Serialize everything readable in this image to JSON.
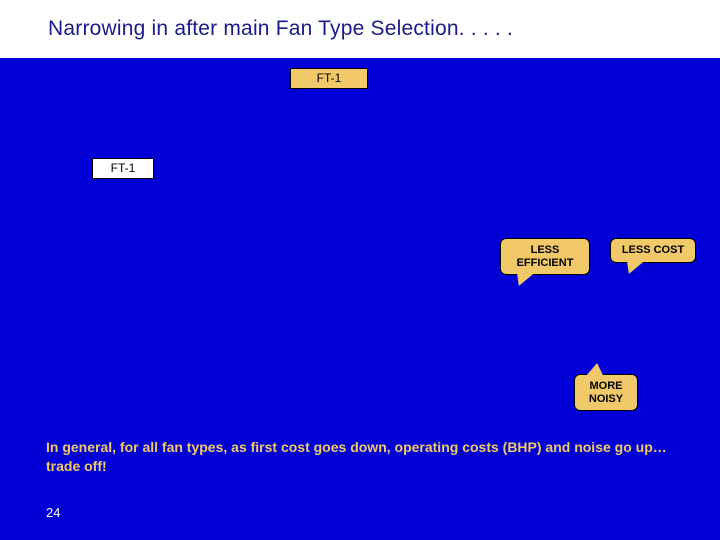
{
  "title": "Narrowing in after main Fan Type Selection. . . . .",
  "labels": {
    "ft1_top": "FT-1",
    "ft1_left": "FT-1"
  },
  "callouts": {
    "less_efficient": "LESS EFFICIENT",
    "less_cost": "LESS COST",
    "more_noisy": "MORE NOISY"
  },
  "summary": "In general, for all fan types, as first cost goes down, operating costs (BHP) and noise go up…trade off!",
  "page_number": "24",
  "colors": {
    "background": "#0000d6",
    "accent": "#f2c968",
    "title": "#1a1a8a"
  }
}
